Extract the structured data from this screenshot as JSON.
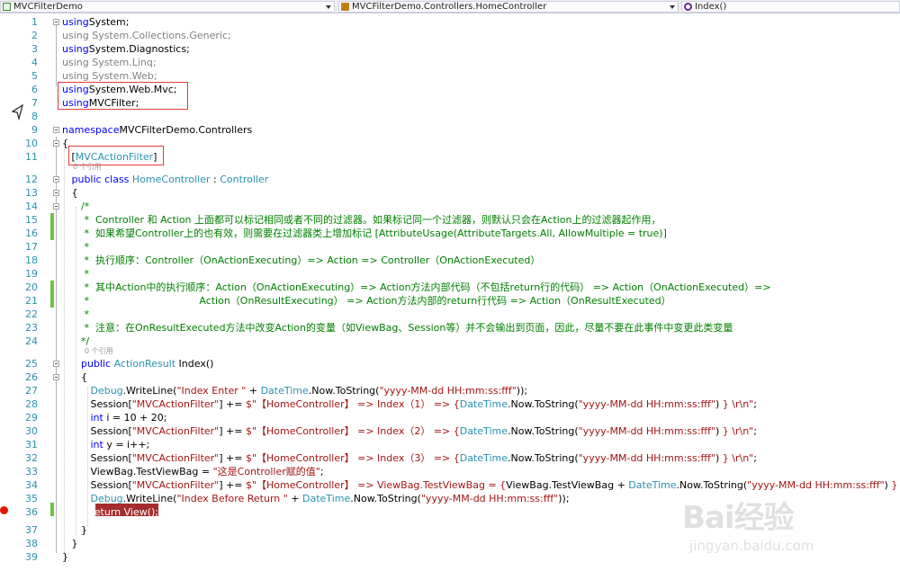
{
  "navbar": {
    "project": "MVCFilterDemo",
    "type": "MVCFilterDemo.Controllers.HomeController",
    "member": "Index()",
    "project_icon": "csharp-project-icon",
    "type_icon": "class-icon",
    "member_icon": "method-icon"
  },
  "editor": {
    "code_lens": {
      "refs_a": "0 个引用",
      "refs_b": "0 个引用"
    },
    "lines": [
      {
        "n": "1",
        "t": [
          [
            "kw",
            "using"
          ],
          [
            "",
            "System;"
          ]
        ]
      },
      {
        "n": "2",
        "t": [
          [
            "gr",
            "using System.Collections.Generic;"
          ]
        ]
      },
      {
        "n": "3",
        "t": [
          [
            "kw",
            "using"
          ],
          [
            "",
            "System.Diagnostics;"
          ]
        ]
      },
      {
        "n": "4",
        "t": [
          [
            "gr",
            "using System.Linq;"
          ]
        ]
      },
      {
        "n": "5",
        "t": [
          [
            "gr",
            "using System.Web;"
          ]
        ]
      },
      {
        "n": "6",
        "t": [
          [
            "kw",
            "using"
          ],
          [
            "",
            "System.Web.Mvc;"
          ]
        ]
      },
      {
        "n": "7",
        "t": [
          [
            "kw",
            "using"
          ],
          [
            "",
            "MVCFilter;"
          ]
        ]
      },
      {
        "n": "8",
        "t": []
      },
      {
        "n": "9",
        "t": [
          [
            "kw",
            "namespace"
          ],
          [
            "",
            "MVCFilterDemo.Controllers"
          ]
        ]
      },
      {
        "n": "10",
        "t": [
          [
            "",
            "{"
          ]
        ]
      },
      {
        "n": "11",
        "t": [
          [
            "",
            "   ["
          ],
          [
            "ty",
            "MVCActionFilter"
          ],
          [
            "",
            "]"
          ]
        ]
      },
      {
        "n": "12",
        "t": [
          [
            "",
            "   "
          ],
          [
            "kw",
            "public"
          ],
          [
            "",
            " "
          ],
          [
            "kw",
            "class"
          ],
          [
            "",
            " "
          ],
          [
            "ty",
            "HomeController"
          ],
          [
            "",
            " : "
          ],
          [
            "ty",
            "Controller"
          ]
        ]
      },
      {
        "n": "13",
        "t": [
          [
            "",
            "   {"
          ]
        ]
      },
      {
        "n": "14",
        "t": [
          [
            "cm",
            "      /*"
          ]
        ]
      },
      {
        "n": "15",
        "t": [
          [
            "cm",
            "       *  Controller 和 Action 上面都可以标记相同或者不同的过滤器。如果标记同一个过滤器，则默认只会在Action上的过滤器起作用，"
          ]
        ]
      },
      {
        "n": "16",
        "t": [
          [
            "cm",
            "       *  如果希望Controller上的也有效，则需要在过滤器类上增加标记 [AttributeUsage(AttributeTargets.All, AllowMultiple = true)]"
          ]
        ]
      },
      {
        "n": "17",
        "t": [
          [
            "cm",
            "       *"
          ]
        ]
      },
      {
        "n": "18",
        "t": [
          [
            "cm",
            "       *  执行顺序：Controller（OnActionExecuting）=> Action => Controller（OnActionExecuted）"
          ]
        ]
      },
      {
        "n": "19",
        "t": [
          [
            "cm",
            "       *"
          ]
        ]
      },
      {
        "n": "20",
        "t": [
          [
            "cm",
            "       *  其中Action中的执行顺序：Action（OnActionExecuting）=> Action方法内部代码（不包括return行的代码） => Action（OnActionExecuted）=>"
          ]
        ]
      },
      {
        "n": "21",
        "t": [
          [
            "cm",
            "       *                                   Action（OnResultExecuting） => Action方法内部的return行代码 => Action（OnResultExecuted）"
          ]
        ]
      },
      {
        "n": "22",
        "t": [
          [
            "cm",
            "       *"
          ]
        ]
      },
      {
        "n": "23",
        "t": [
          [
            "cm",
            "       *  注意：在OnResultExecuted方法中改变Action的变量（如ViewBag、Session等）并不会输出到页面，因此，尽量不要在此事件中变更此类变量"
          ]
        ]
      },
      {
        "n": "24",
        "t": [
          [
            "cm",
            "      */"
          ]
        ]
      },
      {
        "n": "25",
        "t": [
          [
            "",
            "      "
          ],
          [
            "kw",
            "public"
          ],
          [
            "",
            " "
          ],
          [
            "ty",
            "ActionResult"
          ],
          [
            "",
            " Index()"
          ]
        ]
      },
      {
        "n": "26",
        "t": [
          [
            "",
            "      {"
          ]
        ]
      },
      {
        "n": "27",
        "t": [
          [
            "",
            "         "
          ],
          [
            "ty",
            "Debug"
          ],
          [
            "",
            ".WriteLine("
          ],
          [
            "st",
            "\"Index Enter \""
          ],
          [
            "",
            " + "
          ],
          [
            "ty",
            "DateTime"
          ],
          [
            "",
            ".Now.ToString("
          ],
          [
            "st",
            "\"yyyy-MM-dd HH:mm:ss:fff\""
          ],
          [
            "",
            "));"
          ]
        ]
      },
      {
        "n": "28",
        "t": [
          [
            "",
            "         Session["
          ],
          [
            "st",
            "\"MVCActionFilter\""
          ],
          [
            "",
            "] += "
          ],
          [
            "st",
            "$\"【HomeController】 => Index（1） => {"
          ],
          [
            "ty",
            "DateTime"
          ],
          [
            "",
            ".Now.ToString("
          ],
          [
            "st",
            "\"yyyy-MM-dd HH:mm:ss:fff\""
          ],
          [
            "",
            ") "
          ],
          [
            "st",
            "} \\r\\n\""
          ],
          [
            "",
            ";"
          ]
        ]
      },
      {
        "n": "29",
        "t": [
          [
            "",
            "         "
          ],
          [
            "kw",
            "int"
          ],
          [
            "",
            " i = 10 + 20;"
          ]
        ]
      },
      {
        "n": "30",
        "t": [
          [
            "",
            "         Session["
          ],
          [
            "st",
            "\"MVCActionFilter\""
          ],
          [
            "",
            "] += "
          ],
          [
            "st",
            "$\"【HomeController】 => Index（2） => {"
          ],
          [
            "ty",
            "DateTime"
          ],
          [
            "",
            ".Now.ToString("
          ],
          [
            "st",
            "\"yyyy-MM-dd HH:mm:ss:fff\""
          ],
          [
            "",
            ") "
          ],
          [
            "st",
            "} \\r\\n\""
          ],
          [
            "",
            ";"
          ]
        ]
      },
      {
        "n": "31",
        "t": [
          [
            "",
            "         "
          ],
          [
            "kw",
            "int"
          ],
          [
            "",
            " y = i++;"
          ]
        ]
      },
      {
        "n": "32",
        "t": [
          [
            "",
            "         Session["
          ],
          [
            "st",
            "\"MVCActionFilter\""
          ],
          [
            "",
            "] += "
          ],
          [
            "st",
            "$\"【HomeController】 => Index（3） => {"
          ],
          [
            "ty",
            "DateTime"
          ],
          [
            "",
            ".Now.ToString("
          ],
          [
            "st",
            "\"yyyy-MM-dd HH:mm:ss:fff\""
          ],
          [
            "",
            ") "
          ],
          [
            "st",
            "} \\r\\n\""
          ],
          [
            "",
            ";"
          ]
        ]
      },
      {
        "n": "33",
        "t": [
          [
            "",
            "         ViewBag.TestViewBag = "
          ],
          [
            "st",
            "\"这是Controller赋的值\""
          ],
          [
            "",
            ";"
          ]
        ]
      },
      {
        "n": "34",
        "t": [
          [
            "",
            "         Session["
          ],
          [
            "st",
            "\"MVCActionFilter\""
          ],
          [
            "",
            "] += "
          ],
          [
            "st",
            "$\"【HomeController】 => ViewBag.TestViewBag = {"
          ],
          [
            "",
            "ViewBag.TestViewBag + "
          ],
          [
            "ty",
            "DateTime"
          ],
          [
            "",
            ".Now.ToString("
          ],
          [
            "st",
            "\"yyyy-MM-dd HH:mm:ss:fff\""
          ],
          [
            "",
            ") "
          ],
          [
            "st",
            "} \\r\\n\""
          ],
          [
            "",
            ";"
          ]
        ]
      },
      {
        "n": "35",
        "t": [
          [
            "",
            "         "
          ],
          [
            "ty",
            "Debug"
          ],
          [
            "",
            ".WriteLine("
          ],
          [
            "st",
            "\"Index Before Return \""
          ],
          [
            "",
            " + "
          ],
          [
            "ty",
            "DateTime"
          ],
          [
            "",
            ".Now.ToString("
          ],
          [
            "st",
            "\"yyyy-MM-dd HH:mm:ss:fff\""
          ],
          [
            "",
            "));"
          ]
        ]
      },
      {
        "n": "36",
        "t": [
          [
            "",
            "         "
          ],
          [
            "wh",
            "return View();"
          ]
        ]
      },
      {
        "n": "37",
        "t": [
          [
            "",
            "      }"
          ]
        ]
      },
      {
        "n": "38",
        "t": [
          [
            "",
            "   }"
          ]
        ]
      },
      {
        "n": "39",
        "t": [
          [
            "",
            "}"
          ]
        ]
      }
    ]
  },
  "watermark": {
    "logo": "Bai经验",
    "url": "jingyan.baidu.com"
  }
}
